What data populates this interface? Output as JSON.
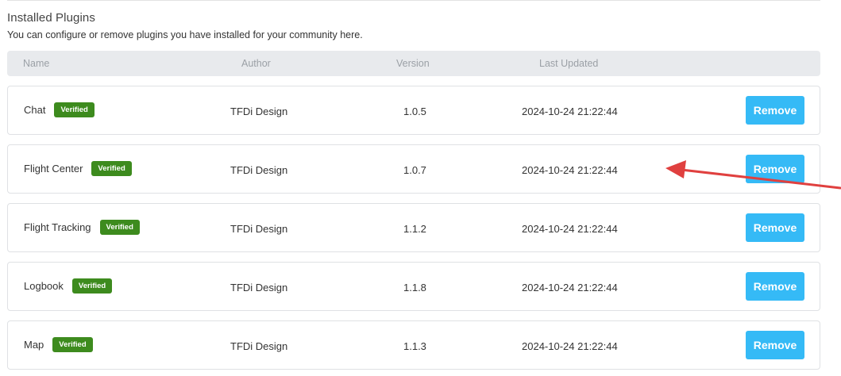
{
  "section": {
    "title": "Installed Plugins",
    "description": "You can configure or remove plugins you have installed for your community here."
  },
  "table": {
    "headers": {
      "name": "Name",
      "author": "Author",
      "version": "Version",
      "last_updated": "Last Updated"
    },
    "rows": [
      {
        "name": "Chat",
        "badge": "Verified",
        "author": "TFDi Design",
        "version": "1.0.5",
        "last_updated": "2024-10-24 21:22:44",
        "action": "Remove"
      },
      {
        "name": "Flight Center",
        "badge": "Verified",
        "author": "TFDi Design",
        "version": "1.0.7",
        "last_updated": "2024-10-24 21:22:44",
        "action": "Remove"
      },
      {
        "name": "Flight Tracking",
        "badge": "Verified",
        "author": "TFDi Design",
        "version": "1.1.2",
        "last_updated": "2024-10-24 21:22:44",
        "action": "Remove"
      },
      {
        "name": "Logbook",
        "badge": "Verified",
        "author": "TFDi Design",
        "version": "1.1.8",
        "last_updated": "2024-10-24 21:22:44",
        "action": "Remove"
      },
      {
        "name": "Map",
        "badge": "Verified",
        "author": "TFDi Design",
        "version": "1.1.3",
        "last_updated": "2024-10-24 21:22:44",
        "action": "Remove"
      }
    ]
  },
  "colors": {
    "verified_badge": "#3d8b1e",
    "remove_button": "#35baf6",
    "header_background": "#e8eaed",
    "annotation_arrow": "#e0403f"
  },
  "annotation": {
    "icon": "red-arrow-icon",
    "points_to": "Flight Center last updated"
  }
}
